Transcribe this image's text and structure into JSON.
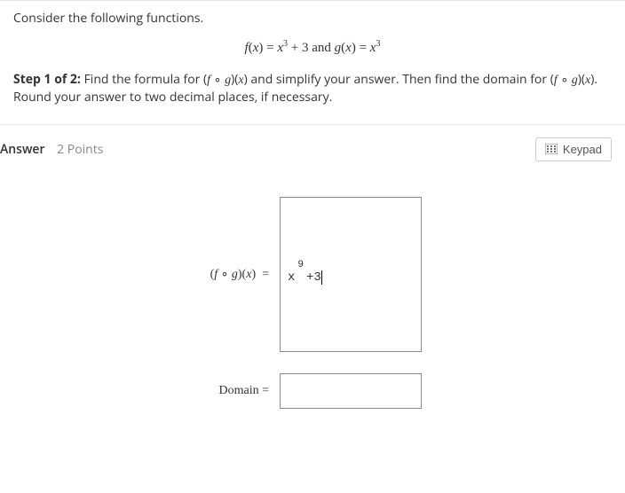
{
  "question": {
    "intro": "Consider the following functions.",
    "formula_html": "f(x) = x³ + 3 and g(x) = x³",
    "step_label": "Step 1 of 2:",
    "step_text": "Find the formula for (f ∘ g)(x) and simplify your answer. Then find the domain for (f ∘ g)(x). Round your answer to two decimal places, if necessary."
  },
  "answer_bar": {
    "label": "Answer",
    "points": "2 Points",
    "keypad": "Keypad"
  },
  "fields": {
    "fog_label_prefix": "(",
    "fog_label_f": "f",
    "fog_label_dot": " ∘ ",
    "fog_label_g": "g",
    "fog_label_suffix": ")(x)  =",
    "fog_value_base": "x",
    "fog_value_exp": "9",
    "fog_value_rest": "+3",
    "domain_label": "Domain  =",
    "domain_value": ""
  }
}
